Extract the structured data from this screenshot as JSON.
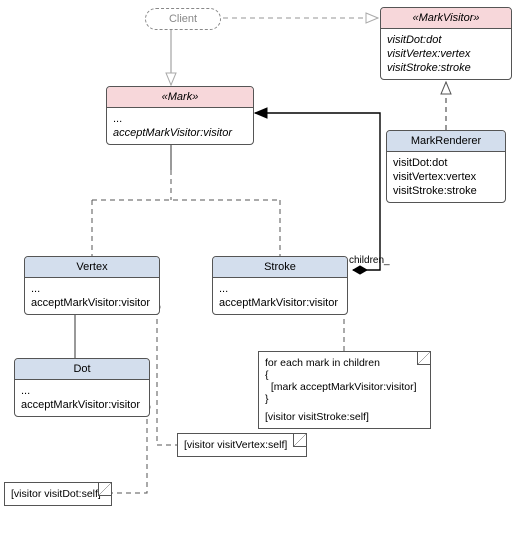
{
  "client": {
    "label": "Client"
  },
  "markVisitor": {
    "title": "«MarkVisitor»",
    "methods": [
      "visitDot:dot",
      "visitVertex:vertex",
      "visitStroke:stroke"
    ]
  },
  "mark": {
    "title": "«Mark»",
    "ellipsis": "...",
    "method": "acceptMarkVisitor:visitor"
  },
  "markRenderer": {
    "title": "MarkRenderer",
    "methods": [
      "visitDot:dot",
      "visitVertex:vertex",
      "visitStroke:stroke"
    ]
  },
  "vertex": {
    "title": "Vertex",
    "ellipsis": "...",
    "method": "acceptMarkVisitor:visitor"
  },
  "stroke": {
    "title": "Stroke",
    "ellipsis": "...",
    "method": "acceptMarkVisitor:visitor"
  },
  "dot": {
    "title": "Dot",
    "ellipsis": "...",
    "method": "acceptMarkVisitor:visitor"
  },
  "noteStroke": {
    "line1": "for each mark in children",
    "line2": "{",
    "line3": "  [mark acceptMarkVisitor:visitor]",
    "line4": "}",
    "line5": "[visitor visitStroke:self]"
  },
  "noteVertex": {
    "text": "[visitor visitVertex:self]"
  },
  "noteDot": {
    "text": "[visitor visitDot:self]"
  },
  "labels": {
    "children": "children_"
  }
}
